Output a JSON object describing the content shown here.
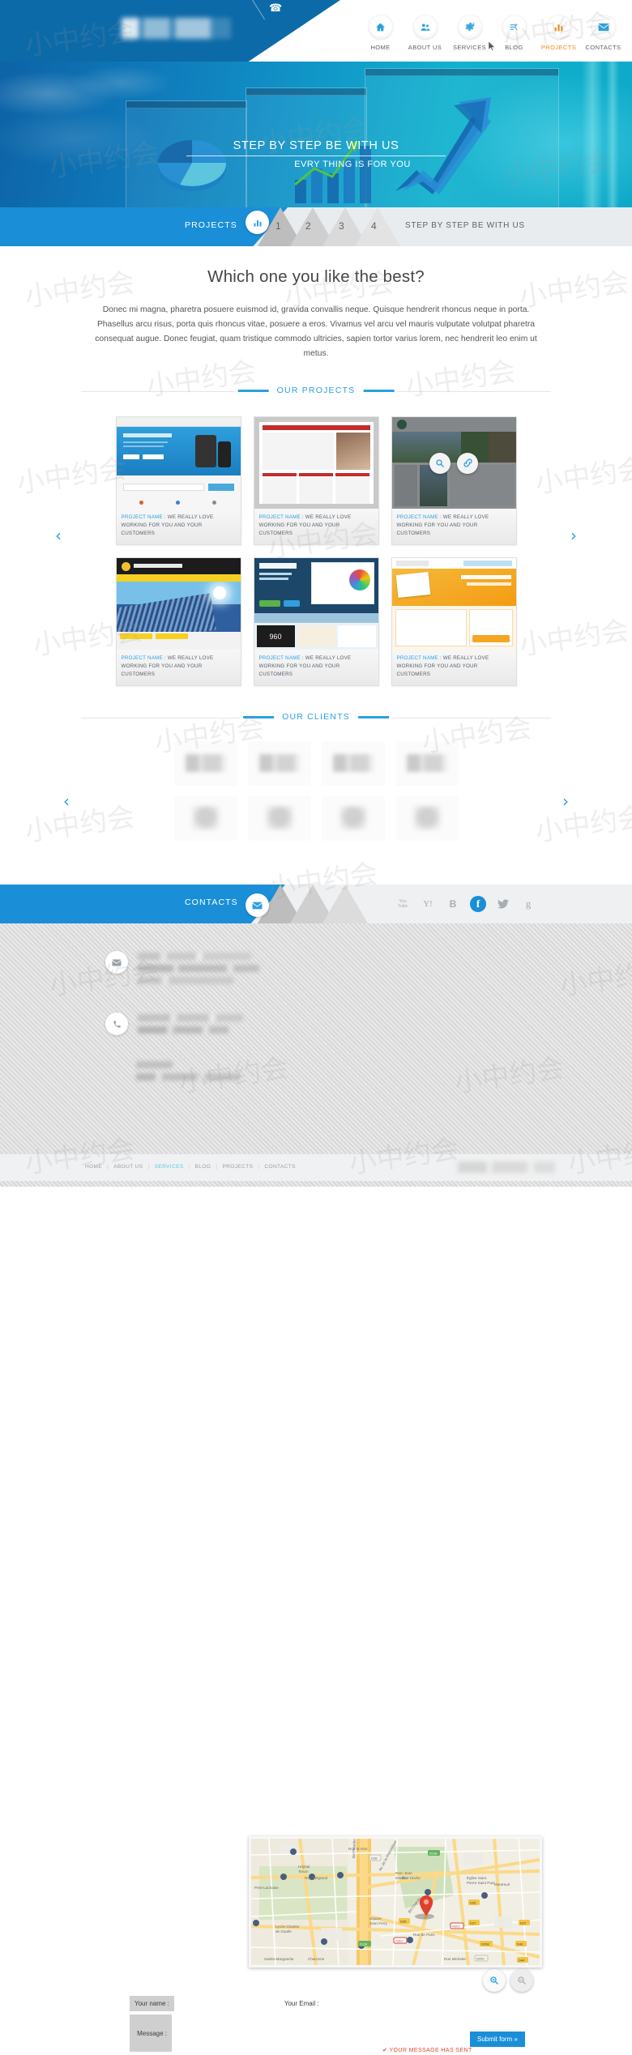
{
  "header": {
    "logo_alt": "company-logo",
    "phone_icon": "phone-icon",
    "nav": [
      {
        "label": "HOME",
        "icon": "home-icon",
        "glyph": "⌂",
        "active": false
      },
      {
        "label": "ABOUT US",
        "icon": "people-icon",
        "glyph": "⛂",
        "active": false
      },
      {
        "label": "SERVICES",
        "icon": "gear-icon",
        "glyph": "⚙",
        "active": false
      },
      {
        "label": "BLOG",
        "icon": "lines-icon",
        "glyph": "≡",
        "active": false
      },
      {
        "label": "PROJECTS",
        "icon": "bar-chart-icon",
        "glyph": "█",
        "active": true
      },
      {
        "label": "CONTACTS",
        "icon": "envelope-icon",
        "glyph": "✉",
        "active": false
      }
    ]
  },
  "hero": {
    "title": "STEP BY STEP BE WITH US",
    "subtitle": "EVRY THING IS FOR YOU"
  },
  "projects_band": {
    "title": "PROJECTS",
    "icon": "bar-chart-icon",
    "steps": [
      "1",
      "2",
      "3",
      "4"
    ],
    "tagline": "STEP BY STEP BE WITH US"
  },
  "main": {
    "heading": "Which one you like the best?",
    "lead": "Donec mi magna, pharetra posuere euismod id, gravida convallis neque. Quisque hendrerit rhoncus neque in porta. Phasellus arcu risus, porta quis rhoncus vitae, posuere a eros. Vivamus vel arcu vel mauris vulputate volutpat pharetra consequat augue. Donec feugiat, quam tristique commodo ultricies, sapien tortor varius lorem, nec hendrerit leo enim ut metus."
  },
  "projects_section": {
    "divider_label": "OUR PROJECTS",
    "prev_arrow": "‹",
    "next_arrow": "›",
    "caption_name": "PROJECT NAME",
    "caption_rest": " : WE REALLY LOVE WORKING FOR YOU AND YOUR CUSTOMERS",
    "overlay_zoom_icon": "magnifier-icon",
    "overlay_link_icon": "link-icon",
    "items": [
      {
        "alt": "comma-responsive-website-thumbnail",
        "hovered": false
      },
      {
        "alt": "magazine-layout-website-thumbnail",
        "hovered": false
      },
      {
        "alt": "travel-nature-website-thumbnail",
        "hovered": true
      },
      {
        "alt": "lotus-solar-energy-website-thumbnail",
        "hovered": false
      },
      {
        "alt": "slickster-app-website-thumbnail",
        "hovered": false
      },
      {
        "alt": "newport-seo-website-thumbnail",
        "hovered": false
      }
    ]
  },
  "clients_section": {
    "divider_label": "OUR CLIENTS",
    "prev_arrow": "‹",
    "next_arrow": "›",
    "logo_count": 8
  },
  "contacts_band": {
    "title": "CONTACTS",
    "icon": "envelope-icon",
    "social": [
      {
        "name": "youtube-icon",
        "glyph": "You",
        "active": false
      },
      {
        "name": "yahoo-icon",
        "glyph": "Y!",
        "active": false
      },
      {
        "name": "blogger-icon",
        "glyph": "B",
        "active": false
      },
      {
        "name": "facebook-icon",
        "glyph": "f",
        "active": true
      },
      {
        "name": "twitter-icon",
        "glyph": "ᵗ",
        "active": false
      },
      {
        "name": "google-icon",
        "glyph": "g",
        "active": false
      }
    ]
  },
  "contact_info": {
    "email_icon": "envelope-icon",
    "phone_icon": "phone-icon",
    "map_alt": "google-map-paris-montreuil",
    "map_marker": "location-marker",
    "zoom_in_icon": "magnifier-plus-icon",
    "zoom_out_icon": "magnifier-minus-icon"
  },
  "form": {
    "name_label": "Your name :",
    "name_value": "",
    "email_label": "Your Email :",
    "email_value": "",
    "message_label": "Message :",
    "message_value": "",
    "submit_label": "Submit form »",
    "sent_message": "✔ YOUR MESSAGE HAS SENT"
  },
  "footer": {
    "links": [
      "HOME",
      "ABOUT US",
      "SERVICES",
      "BLOG",
      "PROJECTS",
      "CONTACTS"
    ],
    "active_link": "SERVICES",
    "separator": "|"
  },
  "watermark": {
    "text": "小中约会"
  },
  "colors": {
    "brand_blue": "#1a8fd8",
    "header_blue": "#0c6aa8",
    "accent_orange": "#f08a1d",
    "band_grey": "#e9ecee",
    "contact_grey": "#d8d8d8",
    "alert_red": "#e0472c"
  }
}
